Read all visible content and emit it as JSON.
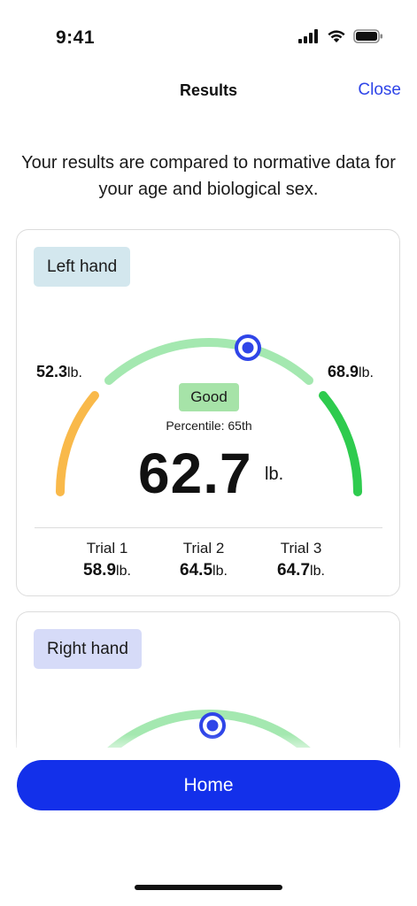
{
  "status_bar": {
    "time": "9:41"
  },
  "nav": {
    "title": "Results",
    "close_label": "Close"
  },
  "intro_text": "Your results are compared to normative data for your age and biological sex.",
  "left_card": {
    "tag": "Left hand",
    "min_value": "52.3",
    "max_value": "68.9",
    "unit": "lb.",
    "status": "Good",
    "percentile": "Percentile: 65th",
    "value": "62.7",
    "trials": [
      {
        "label": "Trial 1",
        "value": "58.9"
      },
      {
        "label": "Trial 2",
        "value": "64.5"
      },
      {
        "label": "Trial 3",
        "value": "64.7"
      }
    ],
    "colors": {
      "low": "#f9b94a",
      "mid": "#a4e8b0",
      "high": "#2ecb4e",
      "marker": "#2f45e8"
    }
  },
  "right_card": {
    "tag": "Right hand"
  },
  "home_button": {
    "label": "Home",
    "color": "#1330ea"
  },
  "accent_color": "#2f45e8"
}
